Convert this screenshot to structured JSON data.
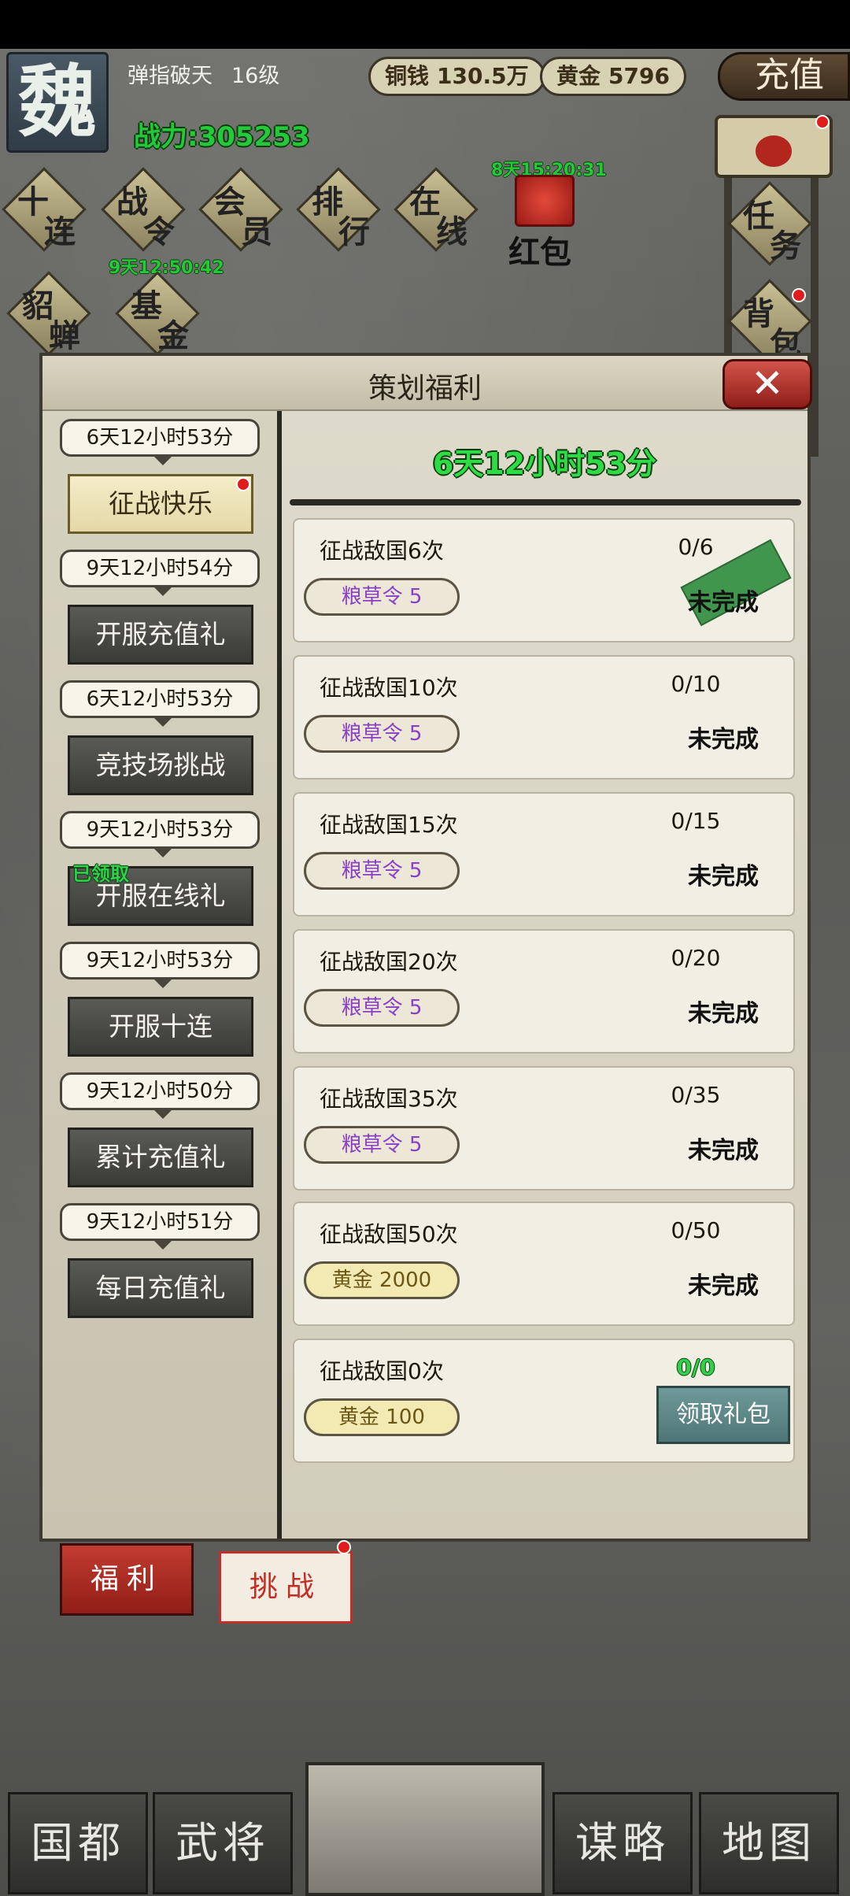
{
  "header": {
    "kingdom": "魏",
    "player_name": "弹指破天",
    "player_level": "16级",
    "power": "战力:305253",
    "copper_label": "铜钱",
    "copper_value": "130.5万",
    "gold_label": "黄金",
    "gold_value": "5796",
    "recharge_label": "充值"
  },
  "menu": {
    "items": [
      {
        "top": "十",
        "bottom": "连"
      },
      {
        "top": "战",
        "bottom": "令"
      },
      {
        "top": "会",
        "bottom": "员"
      },
      {
        "top": "排",
        "bottom": "行"
      },
      {
        "top": "在",
        "bottom": "线"
      }
    ],
    "row2": [
      {
        "top": "貂",
        "bottom": "蝉"
      },
      {
        "top": "基",
        "bottom": "金"
      }
    ],
    "right": [
      {
        "top": "任",
        "bottom": "务"
      },
      {
        "top": "背",
        "bottom": "包"
      }
    ],
    "battlepass_timer": "9天12:50:42",
    "redpack_timer": "8天15:20:31",
    "redpack_label": "红包"
  },
  "modal": {
    "title": "策划福利",
    "close": "✕",
    "countdown": "6天12小时53分",
    "tabs": [
      {
        "timer": "6天12小时53分",
        "label": "征战快乐",
        "active": true
      },
      {
        "timer": "9天12小时54分",
        "label": "开服充值礼"
      },
      {
        "timer": "6天12小时53分",
        "label": "竞技场挑战"
      },
      {
        "timer": "9天12小时53分",
        "label": "开服在线礼",
        "claimed": "已领取"
      },
      {
        "timer": "9天12小时53分",
        "label": "开服十连"
      },
      {
        "timer": "9天12小时50分",
        "label": "累计充值礼"
      },
      {
        "timer": "9天12小时51分",
        "label": "每日充值礼"
      }
    ],
    "tasks": [
      {
        "name": "征战敌国6次",
        "progress": "0/6",
        "reward": "粮草令 5",
        "status": "未完成"
      },
      {
        "name": "征战敌国10次",
        "progress": "0/10",
        "reward": "粮草令 5",
        "status": "未完成"
      },
      {
        "name": "征战敌国15次",
        "progress": "0/15",
        "reward": "粮草令 5",
        "status": "未完成"
      },
      {
        "name": "征战敌国20次",
        "progress": "0/20",
        "reward": "粮草令 5",
        "status": "未完成"
      },
      {
        "name": "征战敌国35次",
        "progress": "0/35",
        "reward": "粮草令 5",
        "status": "未完成"
      },
      {
        "name": "征战敌国50次",
        "progress": "0/50",
        "reward": "黄金 2000",
        "status": "未完成"
      },
      {
        "name": "征战敌国0次",
        "progress": "0/0",
        "reward": "黄金 100",
        "status": "领取礼包"
      }
    ],
    "bottom_tabs": {
      "fuli": "福利",
      "tiaozhan": "挑战"
    }
  },
  "bottom_nav": {
    "guodu": "国都",
    "wujiang": "武将",
    "moulue": "谋略",
    "ditu": "地图"
  },
  "colors": {
    "green_timer": "#24c838",
    "token_purple": "#8a3fc7",
    "red": "#c43b30"
  }
}
